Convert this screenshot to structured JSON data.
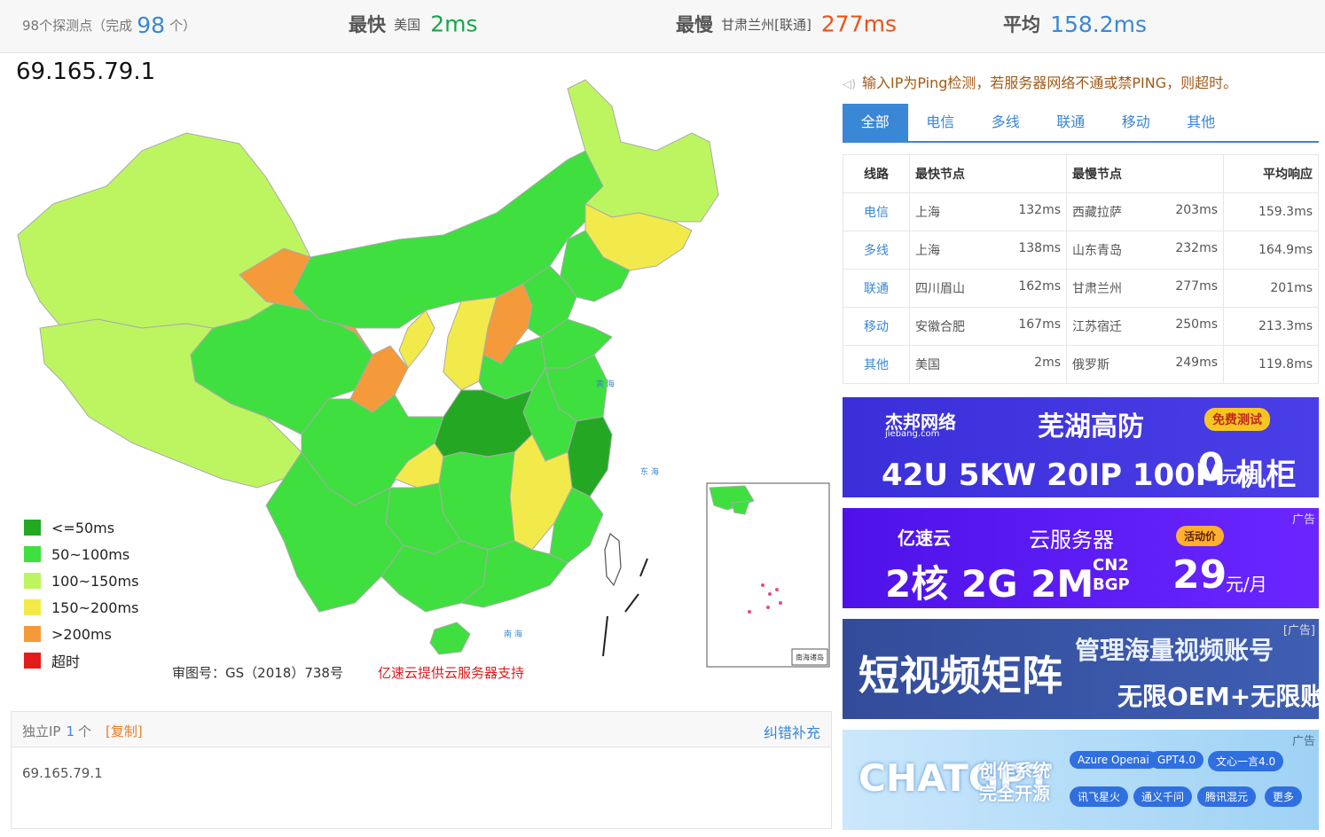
{
  "stats": {
    "probes_prefix": "98个探测点（完成",
    "probes_done": "98",
    "probes_suffix": "个）",
    "fastest_label": "最快",
    "fastest_loc": "美国",
    "fastest_val": "2ms",
    "slowest_label": "最慢",
    "slowest_loc": "甘肃兰州[联通]",
    "slowest_val": "277ms",
    "avg_label": "平均",
    "avg_val": "158.2ms"
  },
  "map": {
    "ip": "69.165.79.1",
    "legend": [
      {
        "label": "<=50ms",
        "color": "#24a824"
      },
      {
        "label": "50~100ms",
        "color": "#3fdf3f"
      },
      {
        "label": "100~150ms",
        "color": "#bdf561"
      },
      {
        "label": "150~200ms",
        "color": "#f2ea4a"
      },
      {
        "label": ">200ms",
        "color": "#f59a3a"
      },
      {
        "label": "超时",
        "color": "#e31b1b"
      }
    ],
    "caption": "审图号：GS（2018）738号",
    "support": "亿速云提供云服务器支持",
    "sea_labels": [
      "黄 海",
      "东 海",
      "南 海",
      "南海诸岛"
    ]
  },
  "ip_panel": {
    "title": "独立IP",
    "count": "1",
    "unit": "个",
    "copy": "[复制]",
    "fix": "纠错补充",
    "ips": "69.165.79.1"
  },
  "notice": "输入IP为Ping检测，若服务器网络不通或禁PING，则超时。",
  "tabs": [
    "全部",
    "电信",
    "多线",
    "联通",
    "移动",
    "其他"
  ],
  "table": {
    "headers": [
      "线路",
      "最快节点",
      "最慢节点",
      "平均响应"
    ],
    "rows": [
      {
        "line": "电信",
        "fast": "上海",
        "fast_ms": "132ms",
        "slow": "西藏拉萨",
        "slow_ms": "203ms",
        "avg": "159.3ms"
      },
      {
        "line": "多线",
        "fast": "上海",
        "fast_ms": "138ms",
        "slow": "山东青岛",
        "slow_ms": "232ms",
        "avg": "164.9ms"
      },
      {
        "line": "联通",
        "fast": "四川眉山",
        "fast_ms": "162ms",
        "slow": "甘肃兰州",
        "slow_ms": "277ms",
        "avg": "201ms"
      },
      {
        "line": "移动",
        "fast": "安徽合肥",
        "fast_ms": "167ms",
        "slow": "江苏宿迁",
        "slow_ms": "250ms",
        "avg": "213.3ms"
      },
      {
        "line": "其他",
        "fast": "美国",
        "fast_ms": "2ms",
        "slow": "俄罗斯",
        "slow_ms": "249ms",
        "avg": "119.8ms"
      }
    ]
  },
  "ads": {
    "ad1": {
      "brand": "杰邦网络",
      "domain": "jiebang.com",
      "headline": "芜湖高防",
      "badge": "免费测试",
      "spec": "42U 5KW 20IP 100M 机柜",
      "price": "0",
      "price_unit": "元/月"
    },
    "ad2": {
      "tag": "广告",
      "brand": "亿速云",
      "product": "云服务器",
      "badge": "活动价",
      "spec": "2核 2G 2M",
      "net1": "CN2",
      "net2": "BGP",
      "price": "29",
      "price_unit": "元/月"
    },
    "ad3": {
      "tag": "[广告]",
      "headline": "短视频矩阵",
      "line1": "管理海量视频账号",
      "line2": "无限OEM+无限账号"
    },
    "ad4": {
      "tag": "广告",
      "headline": "CHATGPT",
      "sub1": "创作系统",
      "sub2": "完全开源",
      "pills": [
        "Azure Openai",
        "GPT4.0",
        "文心一言4.0",
        "讯飞星火",
        "通义千问",
        "腾讯混元",
        "更多"
      ]
    }
  }
}
